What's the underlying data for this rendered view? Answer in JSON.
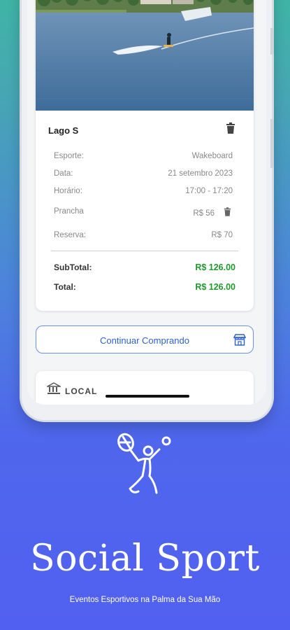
{
  "cart_item": {
    "title": "Lago S",
    "details": [
      {
        "label": "Esporte:",
        "value": "Wakeboard"
      },
      {
        "label": "Data:",
        "value": "21 setembro 2023"
      },
      {
        "label": "Horário:",
        "value": "17:00 - 17:20"
      },
      {
        "label": "Prancha",
        "value": "R$ 56"
      },
      {
        "label": "Reserva:",
        "value": "R$ 70"
      }
    ],
    "subtotal_label": "SubTotal:",
    "subtotal_value": "R$ 126.00",
    "total_label": "Total:",
    "total_value": "R$ 126.00"
  },
  "continue_button": {
    "label": "Continuar Comprando",
    "icon": "store-icon"
  },
  "local_section": {
    "label": "LOCAL",
    "icon": "building-icon"
  },
  "branding": {
    "title": "Social Sport",
    "tagline": "Eventos Esportivos na Palma da Sua Mão",
    "logo_icon": "tennis-player-icon"
  },
  "colors": {
    "accent": "#2f5fd0",
    "price_green": "#1f9a2c"
  }
}
